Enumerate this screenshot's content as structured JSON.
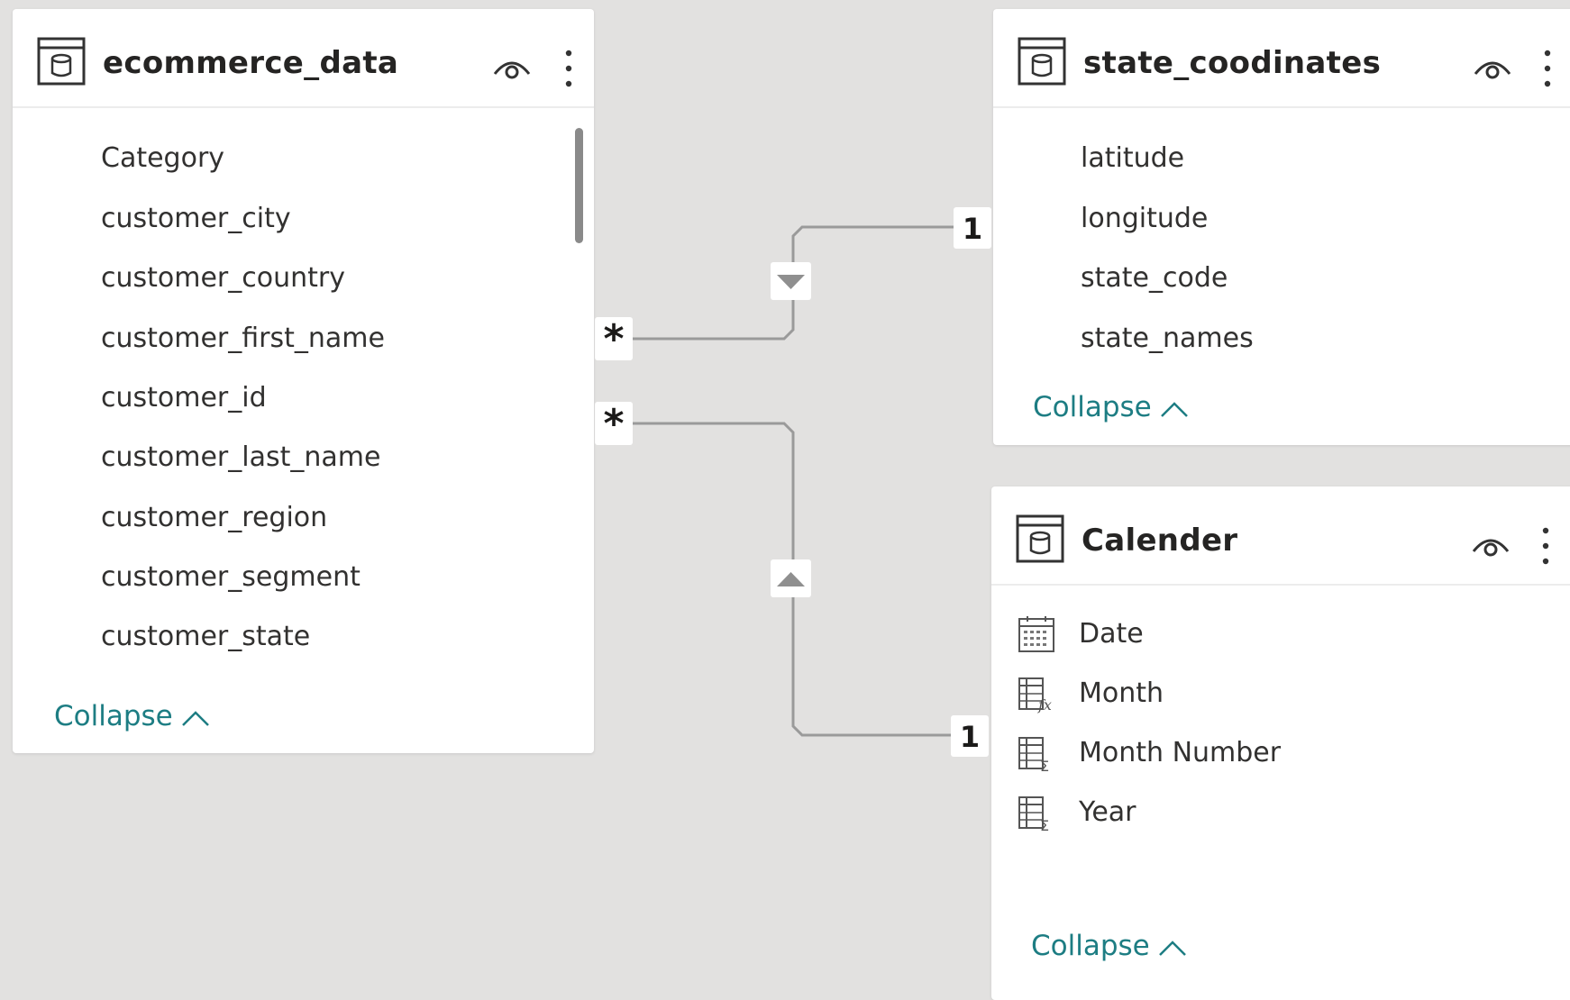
{
  "tables": [
    {
      "name": "ecommerce_data",
      "fields": [
        "Category",
        "customer_city",
        "customer_country",
        "customer_first_name",
        "customer_id",
        "customer_last_name",
        "customer_region",
        "customer_segment",
        "customer_state"
      ],
      "collapse_label": "Collapse"
    },
    {
      "name": "state_coodinates",
      "fields": [
        "latitude",
        "longitude",
        "state_code",
        "state_names"
      ],
      "collapse_label": "Collapse"
    },
    {
      "name": "Calender",
      "fields": [
        {
          "label": "Date",
          "icon": "calendar-icon"
        },
        {
          "label": "Month",
          "icon": "calculated-column-icon"
        },
        {
          "label": "Month Number",
          "icon": "sum-column-icon"
        },
        {
          "label": "Year",
          "icon": "sum-column-icon"
        }
      ],
      "collapse_label": "Collapse"
    }
  ],
  "relationships": [
    {
      "from": "ecommerce_data",
      "to": "state_coodinates",
      "from_cardinality": "*",
      "to_cardinality": "1"
    },
    {
      "from": "ecommerce_data",
      "to": "Calender",
      "from_cardinality": "*",
      "to_cardinality": "1"
    }
  ],
  "colors": {
    "canvas": "#e2e1e0",
    "card": "#ffffff",
    "link": "#1d7d83",
    "line": "#9a9a9a"
  }
}
